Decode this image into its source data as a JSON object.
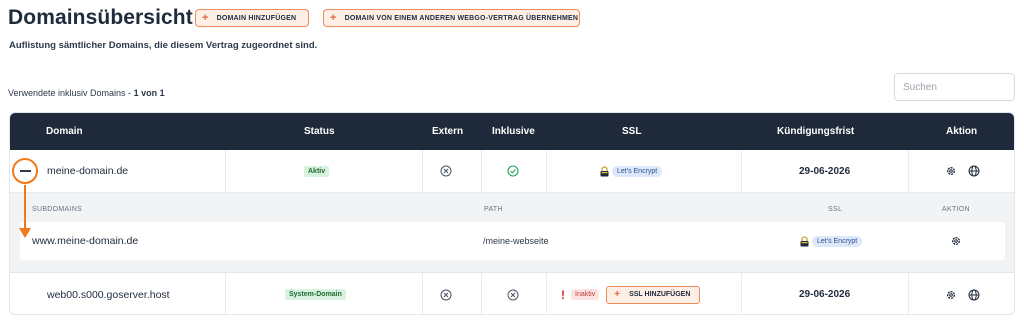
{
  "header": {
    "title": "Domainsübersicht",
    "subtitle": "Auflistung sämtlicher Domains, die diesem Vertrag zugeordnet sind.",
    "add_button": "DOMAIN HINZUFÜGEN",
    "transfer_button": "DOMAIN VON EINEM ANDEREN WEBGO-VERTRAG ÜBERNEHMEN"
  },
  "usage": {
    "label": "Verwendete inklusiv Domains - ",
    "value": "1 von 1"
  },
  "search": {
    "placeholder": "Suchen"
  },
  "table": {
    "columns": {
      "domain": "Domain",
      "status": "Status",
      "extern": "Extern",
      "inklusive": "Inklusive",
      "ssl": "SSL",
      "kuendigung": "Kündigungsfrist",
      "aktion": "Aktion"
    },
    "rows": [
      {
        "domain": "meine-domain.de",
        "status": "Aktiv",
        "ssl": "Let's Encrypt",
        "kuendigung": "29-06-2026"
      },
      {
        "domain": "web00.s000.goserver.host",
        "status": "System-Domain",
        "ssl_status": "Inaktiv",
        "ssl_button": "SSL HINZUFÜGEN",
        "kuendigung": "29-06-2026"
      }
    ],
    "subdomains": {
      "headers": {
        "subdomains": "SUBDOMAINS",
        "path": "PATH",
        "ssl": "SSL",
        "aktion": "AKTION"
      },
      "items": [
        {
          "name": "www.meine-domain.de",
          "path": "/meine-webseite",
          "ssl": "Let's Encrypt"
        }
      ]
    }
  },
  "icons": {
    "extern": "circle-x-icon",
    "inklusive": "circle-check-icon",
    "settings": "gear-icon",
    "web": "globe-icon",
    "ssl": "padlock-icon",
    "warning": "exclamation-icon"
  },
  "colors": {
    "header_bg": "#1e2a3a",
    "accent_orange": "#f07a1a",
    "button_border": "#f08a5a",
    "active_green": "#d9f2df",
    "check_green": "#22a35a"
  }
}
